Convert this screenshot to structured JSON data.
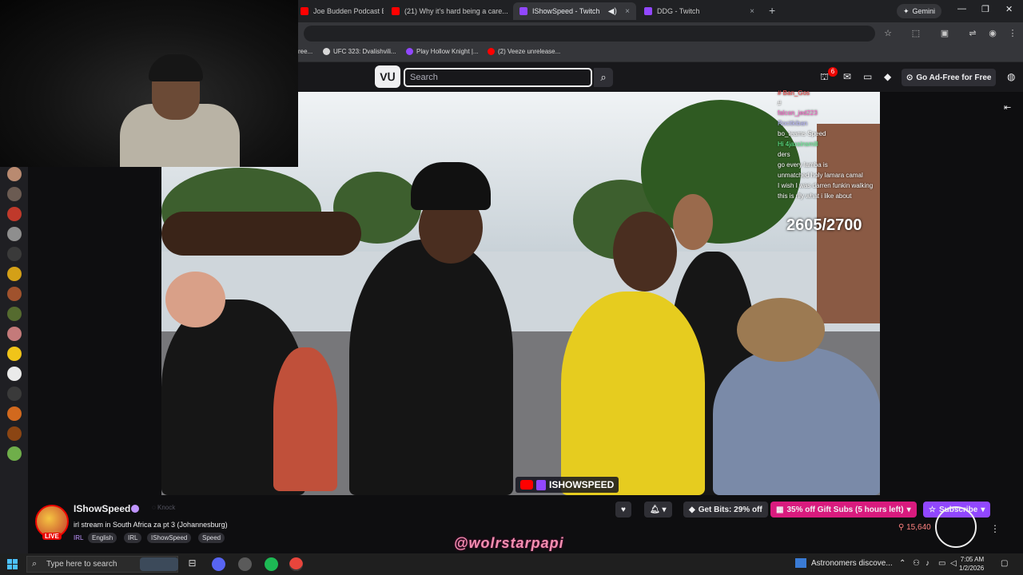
{
  "browser": {
    "tabs": [
      {
        "label": "Joe Budden Podcast E...",
        "fav": "#ff0000",
        "active": false
      },
      {
        "label": "(21) Why it's hard being a care...",
        "fav": "#ff0000",
        "active": false
      },
      {
        "label": "IShowSpeed - Twitch",
        "fav": "#9147ff",
        "active": true
      },
      {
        "label": "DDG - Twitch",
        "fav": "#9147ff",
        "active": false
      }
    ],
    "gemini_label": "Gemini",
    "bookmarks": [
      "ree...",
      "UFC 323: Dvalishvili...",
      "Play Hollow Knight |...",
      "(2) Veeze unrelease..."
    ]
  },
  "twitch": {
    "search_placeholder": "Search",
    "notification_count": "6",
    "ad_free_label": "Go Ad-Free for Free"
  },
  "video": {
    "counter": "2605/2700",
    "watermark": "ISHOWSPEED",
    "chat": [
      "# Ban_Gos",
      "#",
      "falcon_jed223",
      "Rocitkiban",
      "bo_teams Speed",
      "Hi 4jaxsinsmill",
      "ders",
      "go every lamba is",
      "unmatched holy lamara camal",
      "I wish I was darren funkin walking",
      "this is rlly what i like about"
    ]
  },
  "channel": {
    "name": "IShowSpeed",
    "knock_label": "Knock",
    "title": "irl stream in South Africa za pt 3 (Johannesburg)",
    "live_label": "LIVE",
    "category": "IRL",
    "tags": [
      "English",
      "IRL",
      "IShowSpeed",
      "Speed"
    ],
    "bits_label": "Get Bits: 29% off",
    "gift_label": "35% off Gift Subs (5 hours left)",
    "subscribe_label": "Subscribe",
    "viewers": "15,640",
    "overlay_handle": "@wolrstarpapi"
  },
  "taskbar": {
    "search_placeholder": "Type here to search",
    "news": "Astronomers discove...",
    "time": "7:05 AM",
    "date": "1/2/2026"
  }
}
